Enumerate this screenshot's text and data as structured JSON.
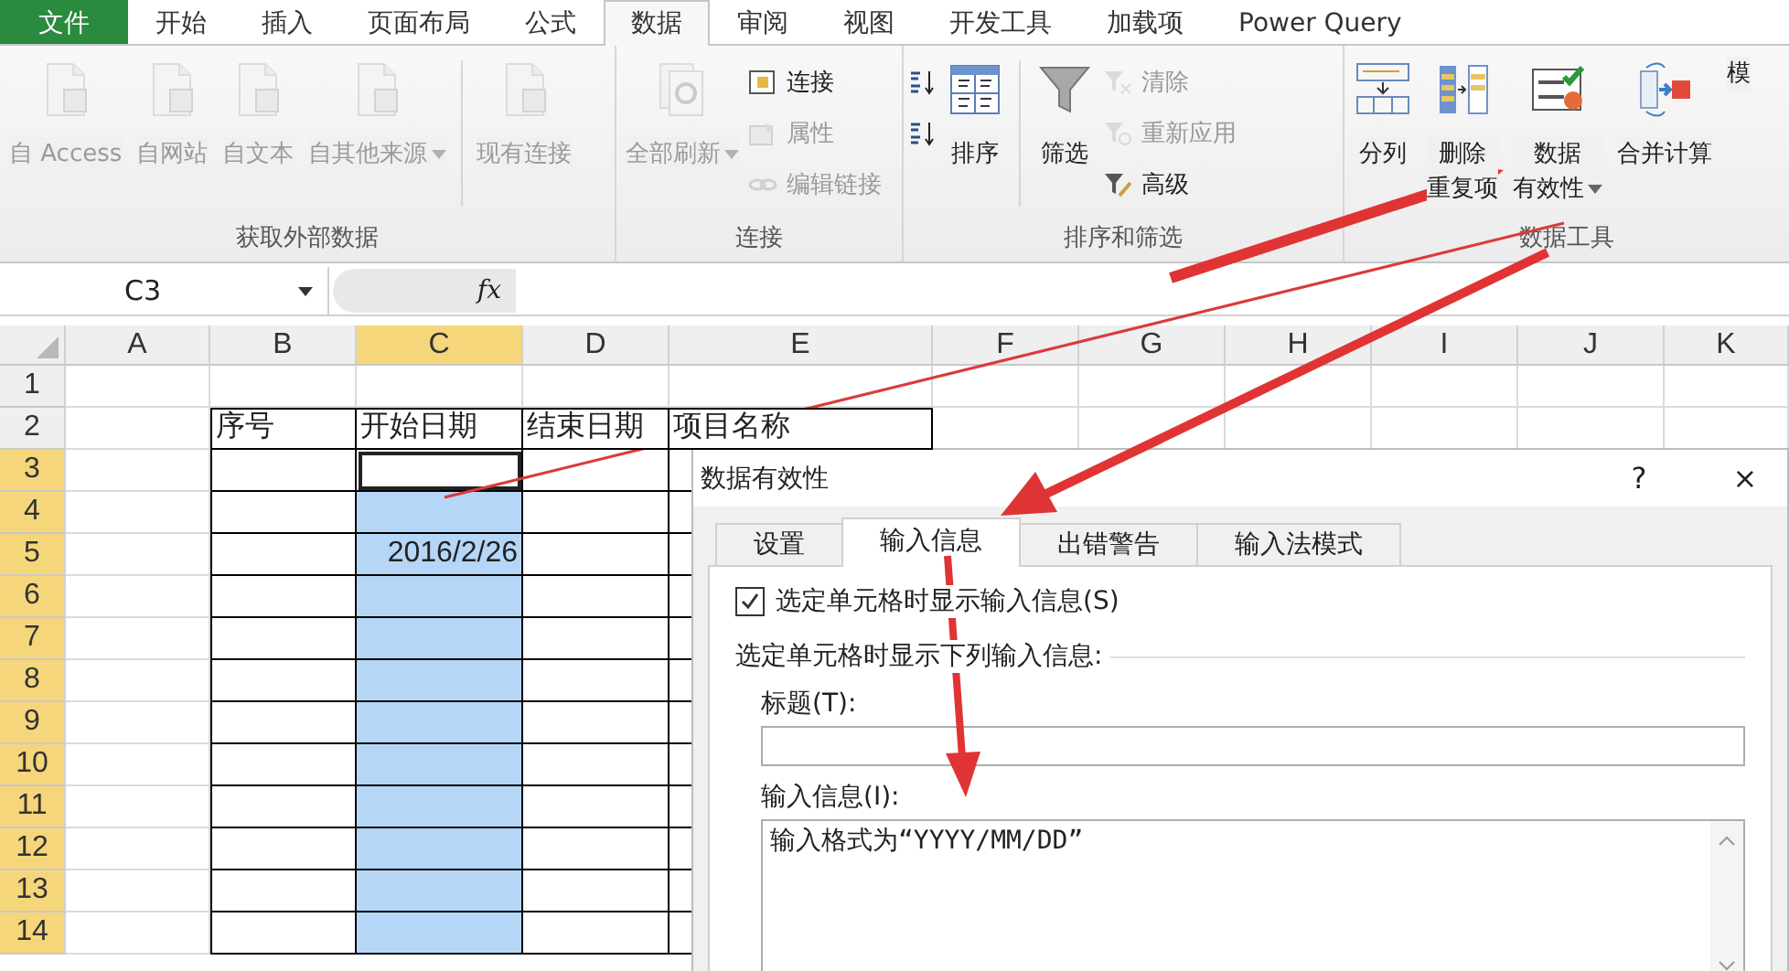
{
  "tabs": [
    {
      "label": "文件",
      "kind": "file",
      "selected": false
    },
    {
      "label": "开始",
      "kind": "tab",
      "selected": false
    },
    {
      "label": "插入",
      "kind": "tab",
      "selected": false
    },
    {
      "label": "页面布局",
      "kind": "tab",
      "selected": false
    },
    {
      "label": "公式",
      "kind": "tab",
      "selected": false
    },
    {
      "label": "数据",
      "kind": "tab",
      "selected": true
    },
    {
      "label": "审阅",
      "kind": "tab",
      "selected": false
    },
    {
      "label": "视图",
      "kind": "tab",
      "selected": false
    },
    {
      "label": "开发工具",
      "kind": "tab",
      "selected": false
    },
    {
      "label": "加载项",
      "kind": "tab",
      "selected": false
    },
    {
      "label": "Power Query",
      "kind": "tab",
      "selected": false
    }
  ],
  "ribbon": {
    "groups": [
      {
        "label": "获取外部数据",
        "items": [
          {
            "kind": "large",
            "label": "自 Access",
            "disabled": true,
            "dropdown": false
          },
          {
            "kind": "large",
            "label": "自网站",
            "disabled": true,
            "dropdown": false
          },
          {
            "kind": "large",
            "label": "自文本",
            "disabled": true,
            "dropdown": false
          },
          {
            "kind": "large",
            "label": "自其他来源",
            "disabled": true,
            "dropdown": true
          },
          {
            "kind": "separator"
          },
          {
            "kind": "large",
            "label": "现有连接",
            "disabled": true,
            "dropdown": false
          }
        ]
      },
      {
        "label": "连接",
        "items": [
          {
            "kind": "large",
            "label": "全部刷新",
            "disabled": true,
            "dropdown": true
          },
          {
            "kind": "stack",
            "items": [
              {
                "label": "连接",
                "disabled": false
              },
              {
                "label": "属性",
                "disabled": true
              },
              {
                "label": "编辑链接",
                "disabled": true
              }
            ]
          }
        ]
      },
      {
        "label": "排序和筛选",
        "items": [
          {
            "kind": "stack",
            "items": [
              {
                "disabled": false
              },
              {
                "disabled": false
              }
            ]
          },
          {
            "kind": "large",
            "label": "排序",
            "disabled": false,
            "dropdown": false
          },
          {
            "kind": "separator"
          },
          {
            "kind": "large",
            "label": "筛选",
            "disabled": false,
            "dropdown": false
          },
          {
            "kind": "stack",
            "items": [
              {
                "label": "清除",
                "disabled": true
              },
              {
                "label": "重新应用",
                "disabled": true
              },
              {
                "label": "高级",
                "disabled": false
              }
            ]
          }
        ]
      },
      {
        "label": "数据工具",
        "items": [
          {
            "kind": "large",
            "label": "分列",
            "disabled": false,
            "dropdown": false
          },
          {
            "kind": "large",
            "lines": [
              "删除",
              "重复项"
            ],
            "disabled": false,
            "dropdown": false
          },
          {
            "kind": "large",
            "lines": [
              "数据",
              "有效性"
            ],
            "disabled": false,
            "dropdown": true
          },
          {
            "kind": "large",
            "label": "合并计算",
            "disabled": false,
            "dropdown": false
          },
          {
            "kind": "large",
            "label": "模",
            "disabled": false,
            "dropdown": false
          }
        ]
      }
    ]
  },
  "formula_bar": {
    "name_box": "C3",
    "function_label": "fx"
  },
  "sheet": {
    "columns": [
      {
        "label": "A",
        "selected": false
      },
      {
        "label": "B",
        "selected": false
      },
      {
        "label": "C",
        "selected": true
      },
      {
        "label": "D",
        "selected": false
      },
      {
        "label": "E",
        "selected": false
      },
      {
        "label": "F",
        "selected": false
      },
      {
        "label": "G",
        "selected": false
      },
      {
        "label": "H",
        "selected": false
      },
      {
        "label": "I",
        "selected": false
      },
      {
        "label": "J",
        "selected": false
      },
      {
        "label": "K",
        "selected": false
      }
    ],
    "rows": [
      {
        "label": "1",
        "selected": false,
        "active": false,
        "kind": "plain"
      },
      {
        "label": "2",
        "selected": false,
        "active": false,
        "kind": "header",
        "cells": [
          "序号",
          "开始日期",
          "结束日期",
          "项目名称"
        ]
      },
      {
        "label": "3",
        "selected": true,
        "active": true,
        "kind": "data",
        "cells": [
          null,
          null,
          null,
          null
        ]
      },
      {
        "label": "4",
        "selected": true,
        "active": false,
        "kind": "data",
        "cells": [
          null,
          null,
          null,
          null
        ]
      },
      {
        "label": "5",
        "selected": true,
        "active": false,
        "kind": "data",
        "cells": [
          null,
          "2016/2/26",
          null,
          null
        ]
      },
      {
        "label": "6",
        "selected": true,
        "active": false,
        "kind": "data",
        "cells": [
          null,
          null,
          null,
          null
        ]
      },
      {
        "label": "7",
        "selected": true,
        "active": false,
        "kind": "data",
        "cells": [
          null,
          null,
          null,
          null
        ]
      },
      {
        "label": "8",
        "selected": true,
        "active": false,
        "kind": "data",
        "cells": [
          null,
          null,
          null,
          null
        ]
      },
      {
        "label": "9",
        "selected": true,
        "active": false,
        "kind": "data",
        "cells": [
          null,
          null,
          null,
          null
        ]
      },
      {
        "label": "10",
        "selected": true,
        "active": false,
        "kind": "data",
        "cells": [
          null,
          null,
          null,
          null
        ]
      },
      {
        "label": "11",
        "selected": true,
        "active": false,
        "kind": "data",
        "cells": [
          null,
          null,
          null,
          null
        ]
      },
      {
        "label": "12",
        "selected": true,
        "active": false,
        "kind": "data",
        "cells": [
          null,
          null,
          null,
          null
        ]
      },
      {
        "label": "13",
        "selected": true,
        "active": false,
        "kind": "data",
        "cells": [
          null,
          null,
          null,
          null
        ]
      },
      {
        "label": "14",
        "selected": true,
        "active": false,
        "kind": "data",
        "cells": [
          null,
          null,
          null,
          null
        ]
      }
    ]
  },
  "dialog": {
    "title": "数据有效性",
    "help": "?",
    "close": "×",
    "tabs": [
      {
        "label": "设置",
        "selected": false
      },
      {
        "label": "输入信息",
        "selected": true
      },
      {
        "label": "出错警告",
        "selected": false
      },
      {
        "label": "输入法模式",
        "selected": false
      }
    ],
    "show_checkbox": {
      "label": "选定单元格时显示输入信息(S)",
      "checked": true
    },
    "section_label": "选定单元格时显示下列输入信息:",
    "title_field": {
      "label": "标题(T):"
    },
    "message_field": {
      "label": "输入信息(I):",
      "value": "输入格式为“YYYY/MM/DD”"
    }
  }
}
